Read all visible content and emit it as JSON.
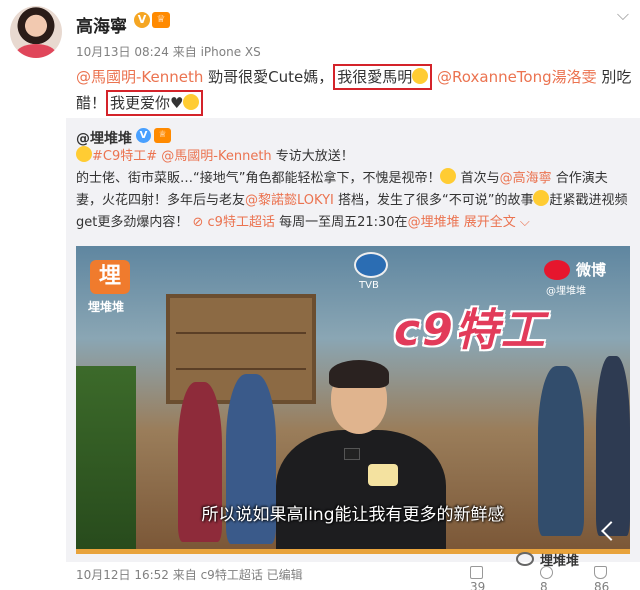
{
  "post": {
    "username": "高海寧",
    "verified_icon": "v-badge-icon",
    "level_icon": "level-badge-icon",
    "time": "10月13日 08:24",
    "source": "来自 iPhone XS",
    "text": {
      "mention1": "@馬國明-Kenneth",
      "part1": " 勁哥很愛Cute媽，",
      "highlight1": "我很愛馬明",
      "mention2": "@RoxanneTong湯洛雯",
      "part2": " 別吃醋！",
      "highlight2": "我更爱你♥"
    }
  },
  "retweet": {
    "username": "@埋堆堆",
    "hashtag": "#C9特工#",
    "mention1": "@馬國明-Kenneth",
    "line1_tail": " 专访大放送！",
    "line2": "的士佬、街市菜販…“接地气”角色都能轻松拿下，不愧是视帝！",
    "line2b": " 首次与",
    "mention2": "@高海寧",
    "line2c": " 合作演夫妻，火花四射！多年后与老友",
    "mention3": "@黎諾懿LOKYI",
    "line3": " 搭档，发生了很多“不可说”的故事",
    "line3b": "赶紧戳进视频get更多劲爆内容！",
    "superchat": "c9特工超话",
    "schedule": " 每周一至周五21:30在",
    "mention4": "@埋堆堆",
    "expand": "展开全文",
    "video": {
      "logo_text": "埋堆堆",
      "logo_glyph": "埋",
      "tvb": "TVB",
      "title": "c9特工",
      "weibo": "微博",
      "weibo_handle": "@埋堆堆",
      "subtitle": "所以说如果高ling能让我有更多的新鲜感"
    }
  },
  "footer": {
    "time": "10月12日 16:52",
    "source": "来自 c9特工超话",
    "edited": "已编辑",
    "reposts": "39",
    "comments": "8",
    "likes": "86",
    "watermark": "埋堆堆"
  }
}
